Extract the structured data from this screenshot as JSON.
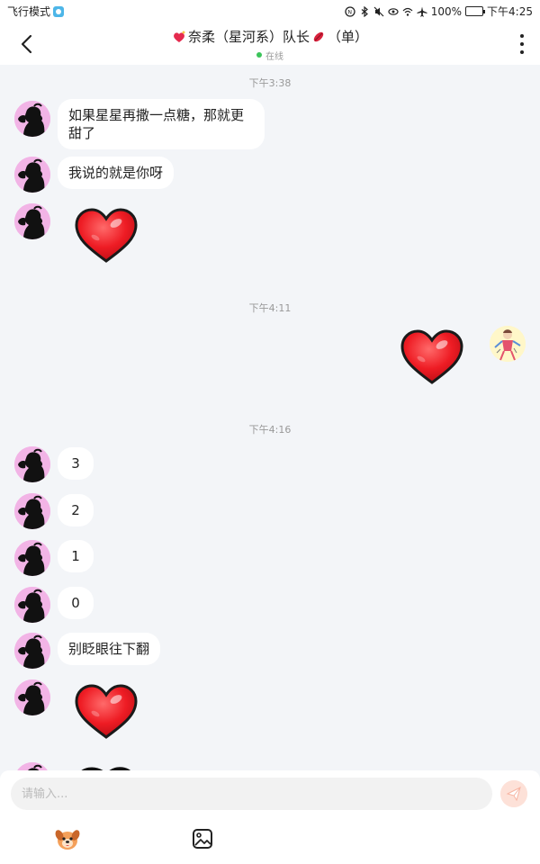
{
  "status_bar": {
    "mode_label": "飞行模式",
    "battery_percent": "100%",
    "time": "下午4:25"
  },
  "header": {
    "title": "奈柔（星河系）队长",
    "title_suffix": "（单）",
    "online_status": "在线",
    "back_icon": "chevron-left-icon",
    "more_icon": "vertical-dots-icon"
  },
  "messages": {
    "ts1": "下午3:38",
    "m1": "如果星星再撒一点糖，那就更甜了",
    "m2": "我说的就是你呀",
    "ts2": "下午4:11",
    "ts3": "下午4:16",
    "m3": "3",
    "m4": "2",
    "m5": "1",
    "m6": "0",
    "m7": "别眨眼往下翻"
  },
  "composer": {
    "placeholder": "请输入...",
    "send_icon": "paper-plane-icon",
    "emoji_icon": "dog-face-icon",
    "image_icon": "image-icon"
  },
  "colors": {
    "background": "#f3f5f8",
    "bubble": "#ffffff",
    "heart": "#ee1c24",
    "online_dot": "#3bc45a"
  }
}
